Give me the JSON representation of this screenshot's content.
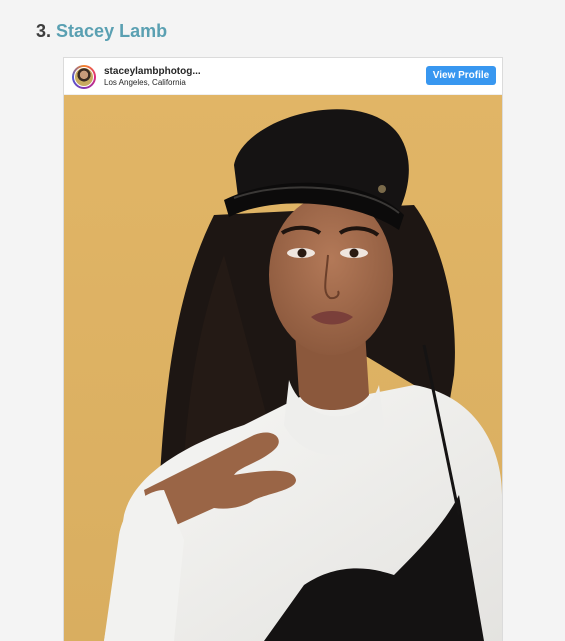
{
  "heading": {
    "number": "3.",
    "name": "Stacey Lamb"
  },
  "embed": {
    "username": "staceylambphotog...",
    "location": "Los Angeles, California",
    "view_profile_label": "View Profile",
    "avatar_icon": "profile-avatar"
  },
  "colors": {
    "page_bg": "#f4f4f4",
    "heading_link": "#5aa0b2",
    "button": "#3897f0",
    "photo_bg": "#e1b566"
  }
}
